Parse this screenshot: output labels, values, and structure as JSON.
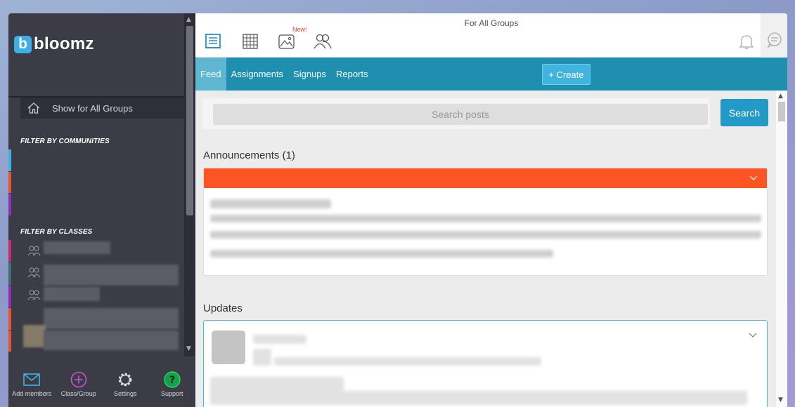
{
  "app": {
    "logo_letter": "b",
    "name": "bloomz"
  },
  "sidebar": {
    "show_all_label": "Show for All Groups",
    "communities_heading": "FILTER BY COMMUNITIES",
    "classes_heading": "FILTER BY CLASSES",
    "community_colors": [
      "#3cb4e5",
      "#e8542c",
      "#8a2fbf"
    ],
    "class_colors": [
      "#c72a6a",
      "#3b6e79",
      "#8a2fbf",
      "#e8542c",
      "#e8542c"
    ]
  },
  "bottom_bar": {
    "items": [
      {
        "label": "Add members",
        "icon": "envelope-icon"
      },
      {
        "label": "Class/Group",
        "icon": "plus-circle-icon"
      },
      {
        "label": "Settings",
        "icon": "gear-icon"
      },
      {
        "label": "Support",
        "icon": "question-icon"
      }
    ]
  },
  "topbar": {
    "title": "For All Groups",
    "new_badge": "New!",
    "icons": [
      "feed-icon",
      "calendar-icon",
      "photos-icon",
      "members-icon",
      "bell-icon",
      "chat-icon"
    ]
  },
  "navbar": {
    "tabs": [
      {
        "label": "Feed",
        "active": true
      },
      {
        "label": "Assignments"
      },
      {
        "label": "Signups"
      },
      {
        "label": "Reports"
      }
    ],
    "create_label": "+ Create"
  },
  "feed": {
    "search_placeholder": "Search posts",
    "search_button": "Search",
    "announcements_title": "Announcements (1)",
    "updates_title": "Updates"
  },
  "colors": {
    "accent_blue": "#1f8fb0",
    "announcement_orange": "#fc5423",
    "sidebar_bg": "#3b3c46"
  }
}
